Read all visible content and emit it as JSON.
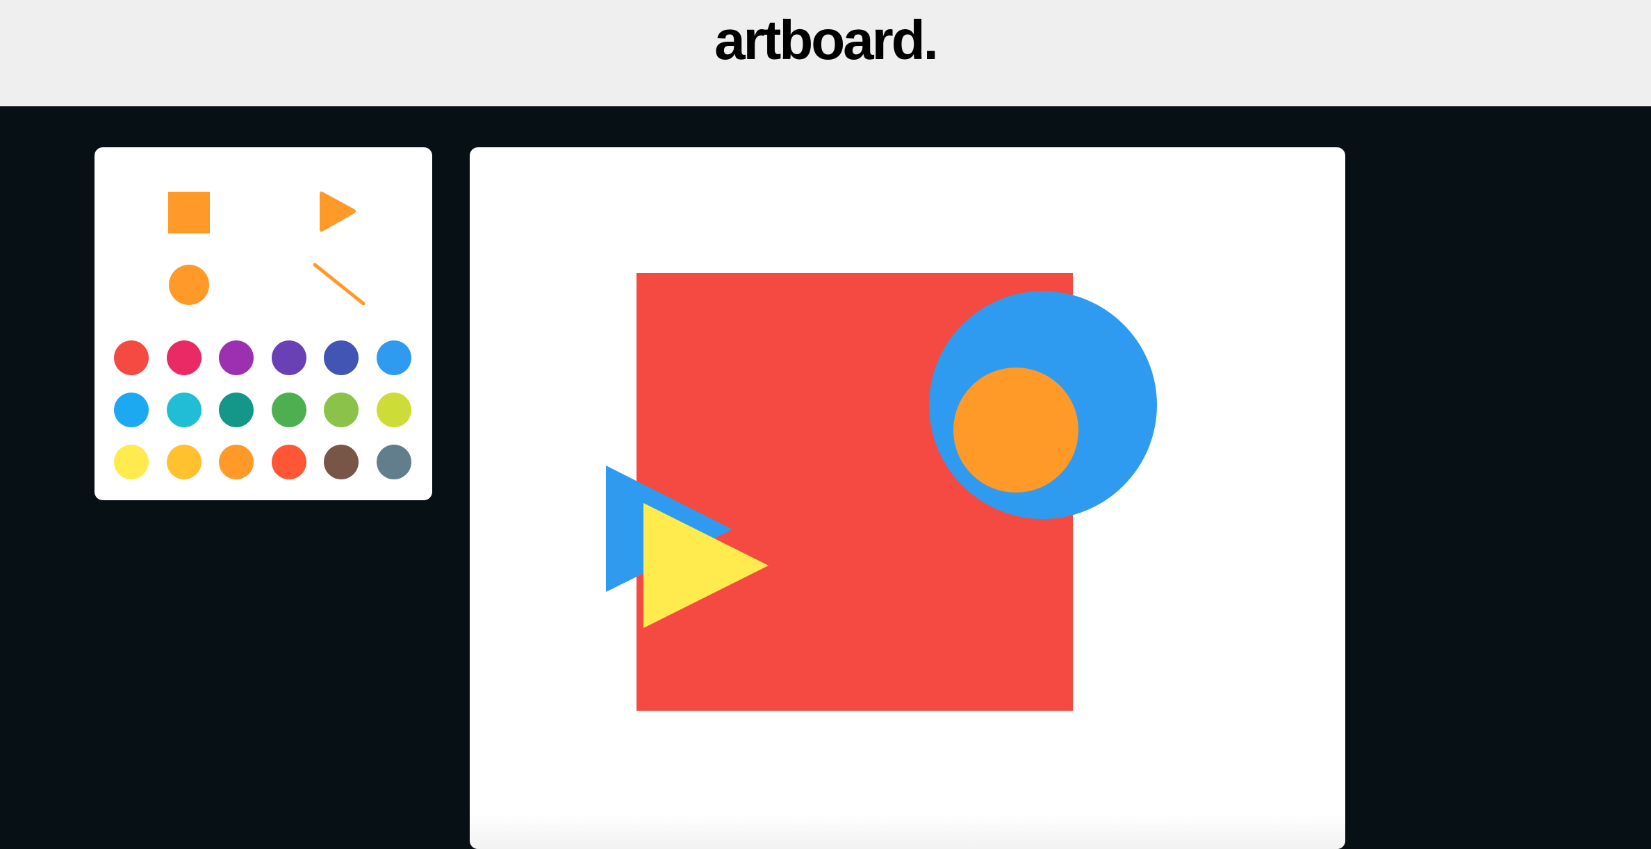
{
  "app": {
    "logo_text": "artboard."
  },
  "tools": [
    {
      "name": "rectangle-tool",
      "icon": "square-icon",
      "color": "#FF9A28"
    },
    {
      "name": "triangle-tool",
      "icon": "triangle-icon",
      "color": "#FF9A28"
    },
    {
      "name": "circle-tool",
      "icon": "circle-icon",
      "color": "#FF9A28"
    },
    {
      "name": "line-tool",
      "icon": "line-icon",
      "color": "#FF9A28"
    }
  ],
  "palette_colors": [
    [
      "#F44A42",
      "#E92A64",
      "#9C30B1",
      "#6A40B5",
      "#4355B4",
      "#2F9BF0"
    ],
    [
      "#1DA8F2",
      "#20BDD4",
      "#149688",
      "#4EAF50",
      "#8BC34A",
      "#CDDC39"
    ],
    [
      "#FFEB4D",
      "#FFC22E",
      "#FF9A28",
      "#FF5736",
      "#795548",
      "#627D8B"
    ]
  ],
  "canvas_shapes": [
    {
      "type": "rectangle",
      "color": "#F44A42"
    },
    {
      "type": "circle",
      "color": "#2F9BF0"
    },
    {
      "type": "circle",
      "color": "#FF9A28"
    },
    {
      "type": "triangle",
      "color": "#2F9BF0"
    },
    {
      "type": "triangle",
      "color": "#FFEB4D"
    }
  ]
}
